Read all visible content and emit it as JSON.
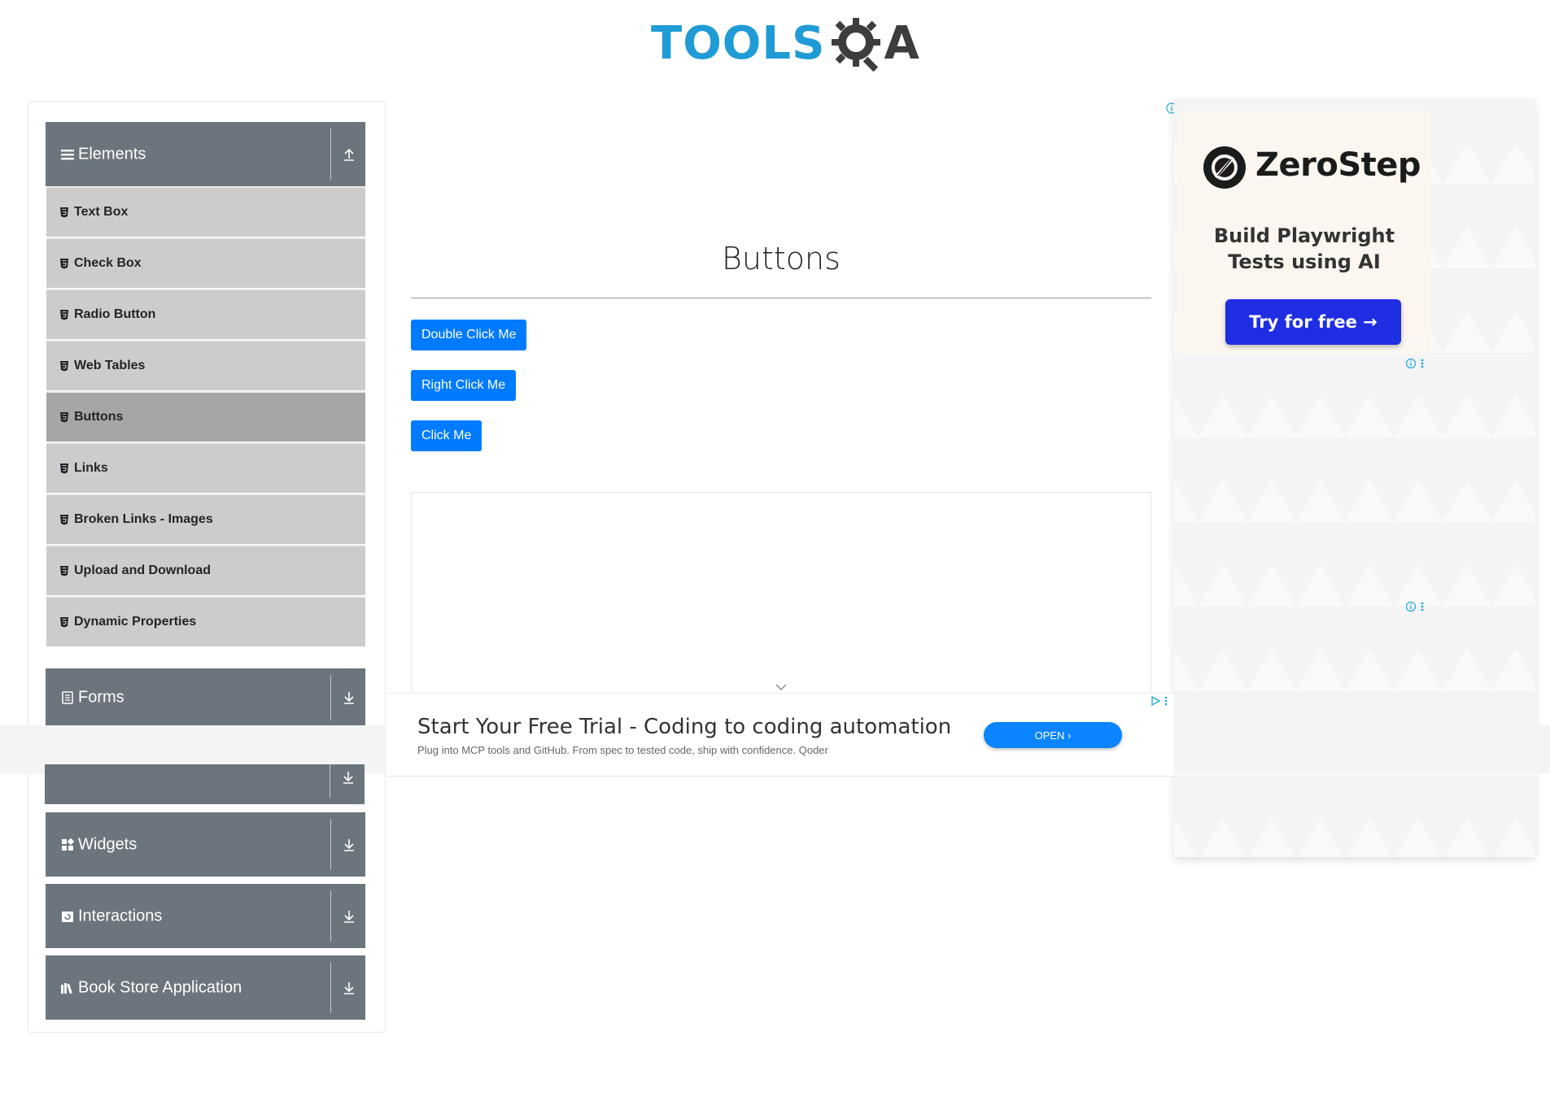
{
  "logo": {
    "part1": "TOOLS",
    "part2": "A"
  },
  "sidebar": {
    "groups": [
      {
        "title": "Elements",
        "icon": "menu-icon",
        "state": "expanded"
      },
      {
        "title": "Forms",
        "icon": "document-icon",
        "state": "collapsed"
      },
      {
        "title": "Widgets",
        "icon": "widgets-icon",
        "state": "collapsed"
      },
      {
        "title": "Interactions",
        "icon": "interactions-icon",
        "state": "collapsed"
      },
      {
        "title": "Book Store Application",
        "icon": "books-icon",
        "state": "collapsed"
      }
    ],
    "items": [
      {
        "label": "Text Box"
      },
      {
        "label": "Check Box"
      },
      {
        "label": "Radio Button"
      },
      {
        "label": "Web Tables"
      },
      {
        "label": "Buttons",
        "active": true
      },
      {
        "label": "Links"
      },
      {
        "label": "Broken Links - Images"
      },
      {
        "label": "Upload and Download"
      },
      {
        "label": "Dynamic Properties"
      }
    ]
  },
  "main": {
    "title": "Buttons",
    "buttons": {
      "double_click": "Double Click Me",
      "right_click": "Right Click Me",
      "click": "Click Me"
    }
  },
  "right_ad": {
    "brand": "ZeroStep",
    "tagline_line1": "Build Playwright",
    "tagline_line2": "Tests using AI",
    "cta": "Try for free →"
  },
  "bottom_ad": {
    "title": "Start Your Free Trial - Coding to coding automation",
    "subtitle": "Plug into MCP tools and GitHub. From spec to tested code, ship with confidence. Qoder",
    "cta": "OPEN ›"
  },
  "colors": {
    "sidebar_header": "#6c757d",
    "menu_item": "#cccccc",
    "menu_item_active": "#a6a6a6",
    "primary_button": "#007bff",
    "logo_blue": "#1f9bd6",
    "zerostep_cta": "#1f2de3"
  }
}
